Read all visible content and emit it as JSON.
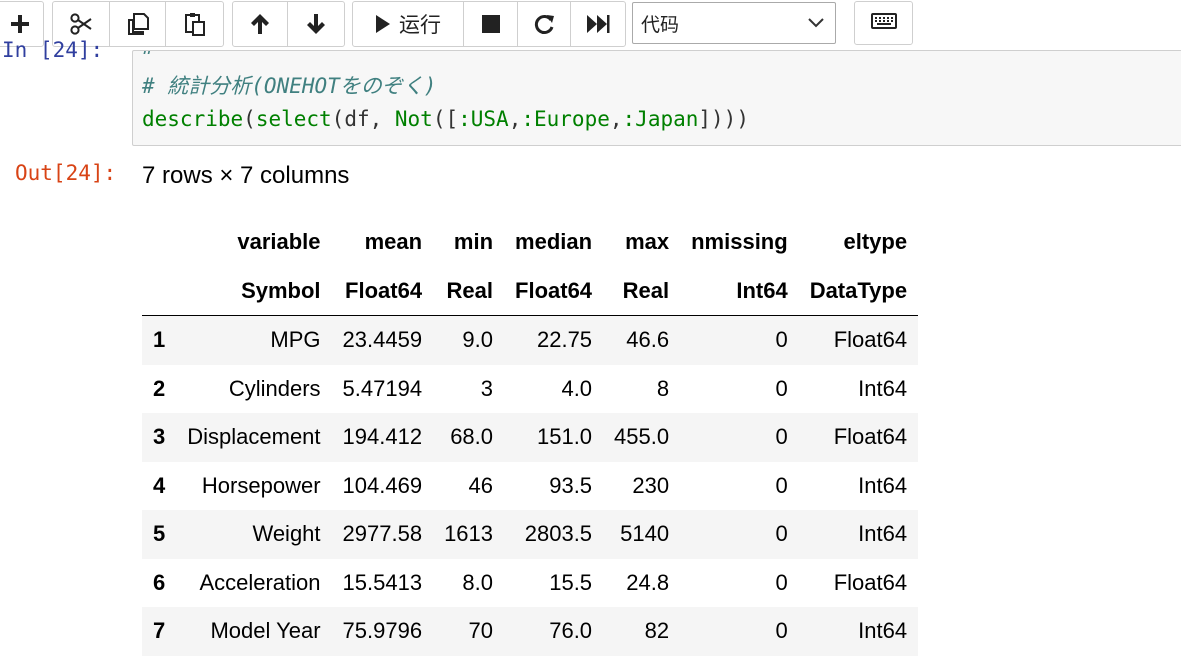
{
  "toolbar": {
    "buttons": [
      {
        "name": "insert-cell-button",
        "icon": "plus-icon"
      },
      {
        "name": "cut-cells-button",
        "icon": "scissors-icon"
      },
      {
        "name": "copy-cells-button",
        "icon": "copy-icon"
      },
      {
        "name": "paste-cells-button",
        "icon": "paste-icon"
      },
      {
        "name": "move-up-button",
        "icon": "arrow-up-icon"
      },
      {
        "name": "move-down-button",
        "icon": "arrow-down-icon"
      },
      {
        "name": "run-button",
        "icon": "play-icon"
      },
      {
        "name": "interrupt-button",
        "icon": "stop-icon"
      },
      {
        "name": "restart-button",
        "icon": "refresh-icon"
      },
      {
        "name": "restart-run-all-button",
        "icon": "fast-forward-icon"
      },
      {
        "name": "command-palette-button",
        "icon": "keyboard-icon"
      }
    ],
    "run_label": "运行",
    "cell_type": "代码"
  },
  "input_cell": {
    "prompt": "In [24]:",
    "lines": {
      "line0": "#",
      "line1": "# 統計分析(ONEHOTをのぞく)",
      "line2": {
        "fn1": "describe",
        "p1": "(",
        "fn2": "select",
        "p2": "(df, ",
        "fn3": "Not",
        "p3": "([",
        "s1": ":USA",
        "c1": ",",
        "s2": ":Europe",
        "c2": ",",
        "s3": ":Japan",
        "p4": "])))"
      }
    }
  },
  "output": {
    "prompt": "Out[24]:",
    "caption": "7 rows × 7 columns",
    "table": {
      "columns": [
        "variable",
        "mean",
        "min",
        "median",
        "max",
        "nmissing",
        "eltype"
      ],
      "types": [
        "Symbol",
        "Float64",
        "Real",
        "Float64",
        "Real",
        "Int64",
        "DataType"
      ],
      "rows": [
        {
          "idx": "1",
          "cells": [
            "MPG",
            "23.4459",
            "9.0",
            "22.75",
            "46.6",
            "0",
            "Float64"
          ]
        },
        {
          "idx": "2",
          "cells": [
            "Cylinders",
            "5.47194",
            "3",
            "4.0",
            "8",
            "0",
            "Int64"
          ]
        },
        {
          "idx": "3",
          "cells": [
            "Displacement",
            "194.412",
            "68.0",
            "151.0",
            "455.0",
            "0",
            "Float64"
          ]
        },
        {
          "idx": "4",
          "cells": [
            "Horsepower",
            "104.469",
            "46",
            "93.5",
            "230",
            "0",
            "Int64"
          ]
        },
        {
          "idx": "5",
          "cells": [
            "Weight",
            "2977.58",
            "1613",
            "2803.5",
            "5140",
            "0",
            "Int64"
          ]
        },
        {
          "idx": "6",
          "cells": [
            "Acceleration",
            "15.5413",
            "8.0",
            "15.5",
            "24.8",
            "0",
            "Float64"
          ]
        },
        {
          "idx": "7",
          "cells": [
            "Model Year",
            "75.9796",
            "70",
            "76.0",
            "82",
            "0",
            "Int64"
          ]
        }
      ]
    }
  }
}
